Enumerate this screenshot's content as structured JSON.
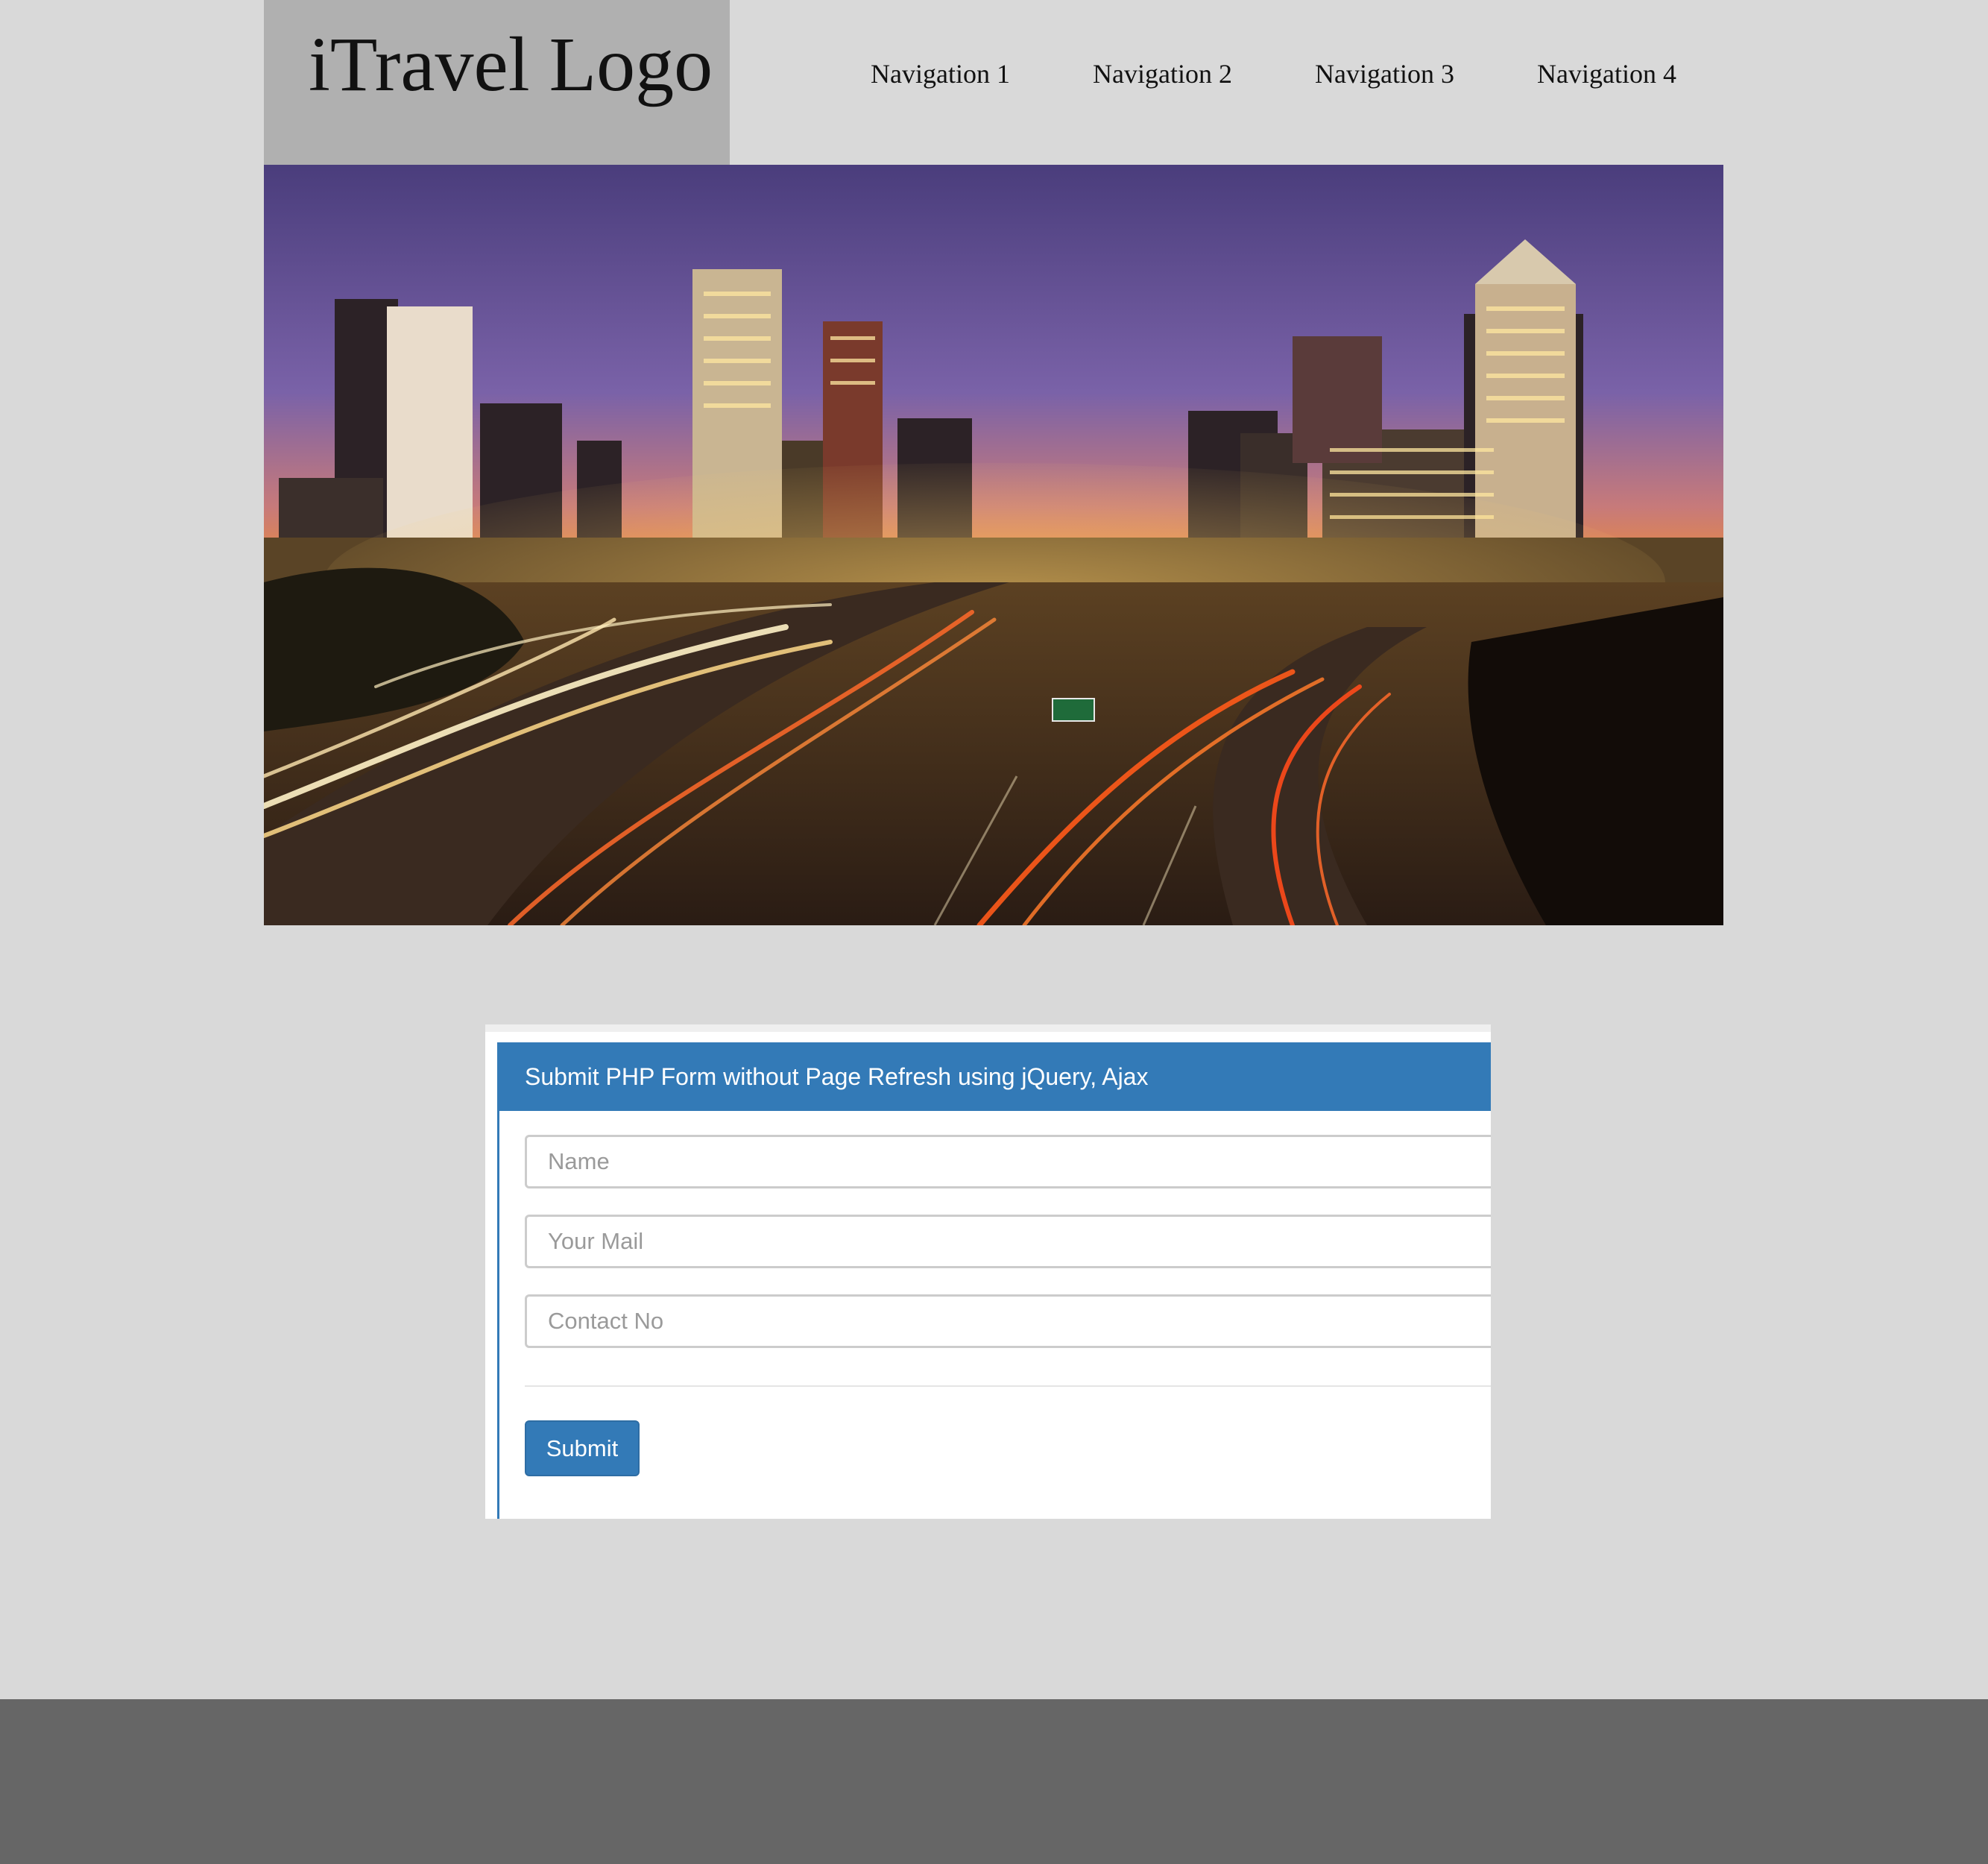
{
  "header": {
    "logo": "iTravel Logo",
    "nav": [
      "Navigation 1",
      "Navigation 2",
      "Navigation 3",
      "Navigation 4"
    ]
  },
  "hero": {
    "image": "city skyline at dusk with highway light trails"
  },
  "form": {
    "heading": "Submit PHP Form without Page Refresh using jQuery, Ajax",
    "fields": [
      {
        "placeholder": "Name",
        "value": ""
      },
      {
        "placeholder": "Your Mail",
        "value": ""
      },
      {
        "placeholder": "Contact No",
        "value": ""
      }
    ],
    "submit_label": "Submit"
  },
  "colors": {
    "page_bg": "#d9d9d9",
    "logo_bg": "#b0b0b0",
    "accent": "#337ab7",
    "footer_bg": "#666666"
  }
}
